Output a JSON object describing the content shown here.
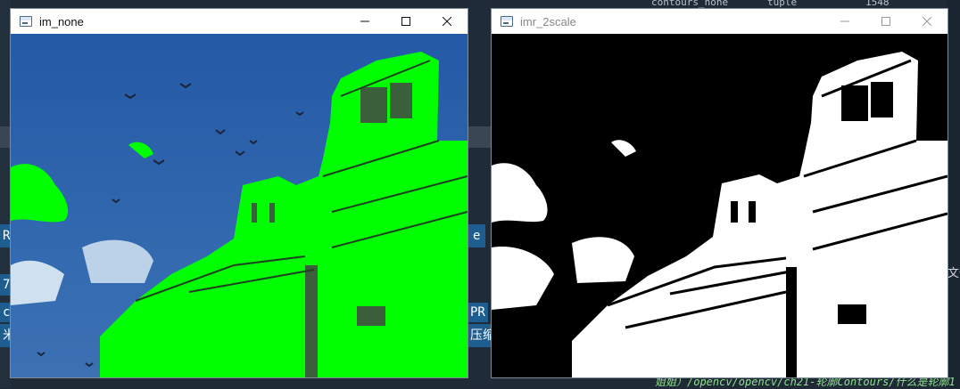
{
  "background": {
    "frag_top": "contours_none",
    "frag_tuple": "tuple",
    "frag_num": "1548",
    "frag_ra": "RA",
    "frag_e": "e",
    "frag_pr": "PR",
    "frag_zip": "压缩",
    "frag_co": "co",
    "frag_mi": "米",
    "frag_file": "文件",
    "frag_path": "姐姐）/opencv/opencv/ch21-轮廓Contours/什么是轮廓1",
    "frag_dot": "7，"
  },
  "window_left": {
    "title": "im_none",
    "image_desc_colors": {
      "sky": "#2f63a8",
      "contour": "#00ff00"
    }
  },
  "window_right": {
    "title": "imr_2scale",
    "image_desc_colors": {
      "fg": "#ffffff",
      "bg": "#000000"
    }
  }
}
